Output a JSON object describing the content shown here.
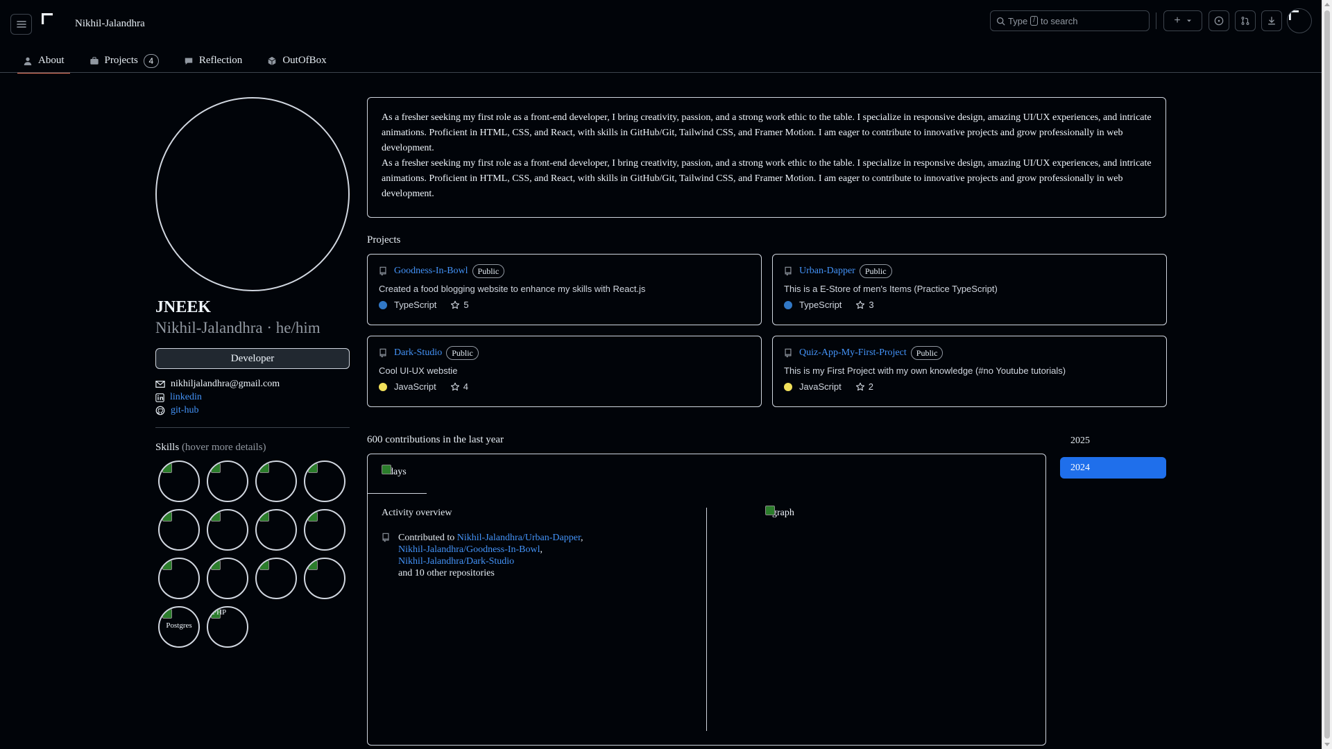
{
  "header": {
    "username": "Nikhil-Jalandhra",
    "search_prefix": "Type",
    "search_key": "/",
    "search_suffix": "to search",
    "create_label": "+"
  },
  "tabs": [
    {
      "label": "About",
      "icon": "person-icon",
      "active": true
    },
    {
      "label": "Projects",
      "icon": "briefcase-icon",
      "count": "4"
    },
    {
      "label": "Reflection",
      "icon": "chat-icon"
    },
    {
      "label": "OutOfBox",
      "icon": "cube-icon"
    }
  ],
  "profile": {
    "display_name": "JNEEK",
    "login": "Nikhil-Jalandhra",
    "separator": "·",
    "pronouns": "he/him",
    "role": "Developer",
    "email": "nikhiljalandhra@gmail.com",
    "linkedin": "linkedin",
    "github": "git-hub"
  },
  "skills": {
    "title": "Skills",
    "hint": "(hover more details)",
    "items": [
      "",
      "",
      "",
      "",
      "",
      "",
      "",
      "",
      "",
      "",
      "",
      "",
      "Postgres",
      "PHP"
    ]
  },
  "bio": {
    "paragraph_1": "As a fresher seeking my first role as a front-end developer, I bring creativity, passion, and a strong work ethic to the table. I specialize in responsive design, amazing UI/UX experiences, and intricate animations. Proficient in HTML, CSS, and React, with skills in GitHub/Git, Tailwind CSS, and Framer Motion. I am eager to contribute to innovative projects and grow professionally in web development.",
    "paragraph_2": "As a fresher seeking my first role as a front-end developer, I bring creativity, passion, and a strong work ethic to the table. I specialize in responsive design, amazing UI/UX experiences, and intricate animations. Proficient in HTML, CSS, and React, with skills in GitHub/Git, Tailwind CSS, and Framer Motion. I am eager to contribute to innovative projects and grow professionally in web development."
  },
  "projects": {
    "title": "Projects",
    "repos": [
      {
        "name": "Goodness-In-Bowl",
        "visibility": "Public",
        "description": "Created a food blogging website to enhance my skills with React.js",
        "language": "TypeScript",
        "lang_color": "#3178c6",
        "stars": "5"
      },
      {
        "name": "Urban-Dapper",
        "visibility": "Public",
        "description": "This is a E-Store of men's Items (Practice TypeScript)",
        "language": "TypeScript",
        "lang_color": "#3178c6",
        "stars": "3"
      },
      {
        "name": "Dark-Studio",
        "visibility": "Public",
        "description": "Cool UI-UX webstie",
        "language": "JavaScript",
        "lang_color": "#f1e05a",
        "stars": "4"
      },
      {
        "name": "Quiz-App-My-First-Project",
        "visibility": "Public",
        "description": "This is my First Project with my own knowledge (#no Youtube tutorials)",
        "language": "JavaScript",
        "lang_color": "#f1e05a",
        "stars": "2"
      }
    ]
  },
  "contributions": {
    "summary": "600 contributions in the last year",
    "days_alt": "days",
    "activity_title": "Activity overview",
    "contributed_to": "Contributed to",
    "repo_1": "Nikhil-Jalandhra/Urban-Dapper",
    "repo_2": "Nikhil-Jalandhra/Goodness-In-Bowl",
    "repo_3": "Nikhil-Jalandhra/Dark-Studio",
    "others": "and 10 other repositories",
    "graph_alt": "graph"
  },
  "years": [
    {
      "label": "2025",
      "active": false
    },
    {
      "label": "2024",
      "active": true
    }
  ],
  "colors": {
    "accent": "#1f6feb",
    "link": "#4493f8",
    "tab_underline": "#f78166",
    "background": "#010409"
  }
}
